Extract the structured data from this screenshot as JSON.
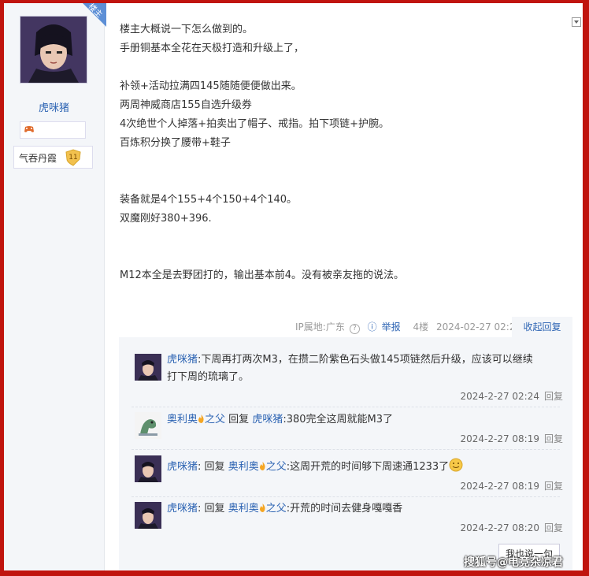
{
  "author": {
    "name": "虎咪猪",
    "badge_level_name": "气吞丹霞",
    "badge_level": "11",
    "corner_tag": "楼主"
  },
  "post": {
    "lines": [
      "楼主大概说一下怎么做到的。",
      "手册铜基本全花在天极打造和升级上了，",
      "补领+活动拉满四145随随便便做出来。",
      "两周神威商店155自选升级券",
      "4次绝世个人掉落+拍卖出了帽子、戒指。拍下项链+护腕。",
      "百炼积分换了腰带+鞋子",
      "装备就是4个155+4个150+4个140。",
      "双魔刚好380+396.",
      "M12本全是去野团打的，输出基本前4。没有被亲友拖的说法。"
    ],
    "ip_label": "IP属地:广东",
    "report_label": "举报",
    "floor": "4楼",
    "time": "2024-02-27 02:21",
    "collapse_label": "收起回复"
  },
  "replies": [
    {
      "user": "虎咪猪",
      "reply_word": "",
      "target": "",
      "text": ":下周再打两次M3，在攒二阶紫色石头做145项链然后升级，应该可以继续",
      "text2": "打下周的琉璃了。",
      "time": "2024-2-27 02:24",
      "action": "回复"
    },
    {
      "user": "奥利奥",
      "user_suffix": "之父",
      "reply_word": "回复",
      "target": "虎咪猪",
      "text": ":380完全这周就能M3了",
      "time": "2024-2-27 08:19",
      "action": "回复"
    },
    {
      "user": "虎咪猪",
      "reply_word": "回复",
      "target": "奥利奥",
      "target_suffix": "之父",
      "text": ":这周开荒的时间够下周速通1233了",
      "time": "2024-2-27 08:19",
      "action": "回复"
    },
    {
      "user": "虎咪猪",
      "reply_word": "回复",
      "target": "奥利奥",
      "target_suffix": "之父",
      "text": ":开荒的时间去健身嘎嘎香",
      "time": "2024-2-27 08:20",
      "action": "回复"
    }
  ],
  "say_button": "我也说一句",
  "watermark": "搜狐号@电竞杂凉君",
  "colors": {
    "link": "#2d64b3",
    "frame": "#c0140e",
    "panel": "#f4f6f9"
  }
}
